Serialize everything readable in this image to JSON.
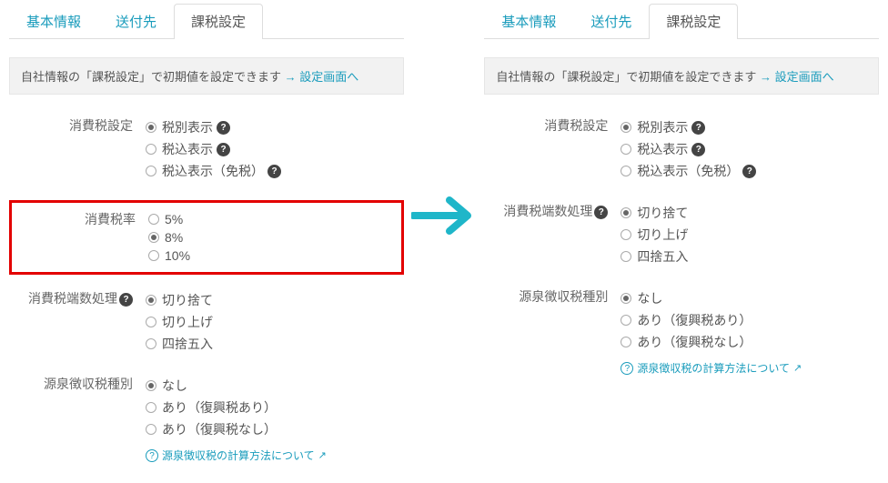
{
  "tabs": {
    "t0": "基本情報",
    "t1": "送付先",
    "t2": "課税設定"
  },
  "notice": {
    "text": "自社情報の「課税設定」で初期値を設定できます ",
    "arrow": "→ ",
    "link": "設定画面へ"
  },
  "left": {
    "s_tax_display": {
      "label": "消費税設定",
      "o0": "税別表示",
      "o1": "税込表示",
      "o2": "税込表示（免税）"
    },
    "s_tax_rate": {
      "label": "消費税率",
      "o0": "5%",
      "o1": "8%",
      "o2": "10%"
    },
    "s_rounding": {
      "label": "消費税端数処理",
      "o0": "切り捨て",
      "o1": "切り上げ",
      "o2": "四捨五入"
    },
    "s_withholding": {
      "label": "源泉徴収税種別",
      "o0": "なし",
      "o1": "あり（復興税あり）",
      "o2": "あり（復興税なし）"
    },
    "help_link": "源泉徴収税の計算方法について"
  },
  "right": {
    "s_tax_display": {
      "label": "消費税設定",
      "o0": "税別表示",
      "o1": "税込表示",
      "o2": "税込表示（免税）"
    },
    "s_rounding": {
      "label": "消費税端数処理",
      "o0": "切り捨て",
      "o1": "切り上げ",
      "o2": "四捨五入"
    },
    "s_withholding": {
      "label": "源泉徴収税種別",
      "o0": "なし",
      "o1": "あり（復興税あり）",
      "o2": "あり（復興税なし）"
    },
    "help_link": "源泉徴収税の計算方法について"
  }
}
